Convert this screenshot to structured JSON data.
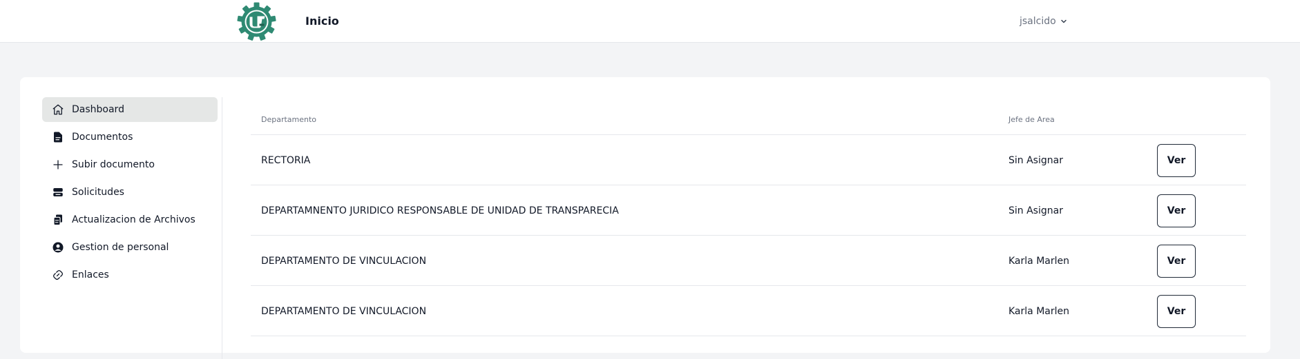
{
  "header": {
    "title": "Inicio",
    "user": "jsalcido",
    "logo_icon": "gear-logo-icon",
    "logo_color": "#2f8a73"
  },
  "sidebar": {
    "items": [
      {
        "label": "Dashboard",
        "icon": "home-icon",
        "active": true
      },
      {
        "label": "Documentos",
        "icon": "document-icon",
        "active": false
      },
      {
        "label": "Subir documento",
        "icon": "plus-icon",
        "active": false
      },
      {
        "label": "Solicitudes",
        "icon": "inbox-stack-icon",
        "active": false
      },
      {
        "label": "Actualizacion de Archivos",
        "icon": "copy-documents-icon",
        "active": false
      },
      {
        "label": "Gestion de personal",
        "icon": "user-circle-icon",
        "active": false
      },
      {
        "label": "Enlaces",
        "icon": "link-icon",
        "active": false
      }
    ]
  },
  "table": {
    "headers": {
      "departamento": "Departamento",
      "jefe": "Jefe de Area"
    },
    "rows": [
      {
        "departamento": "RECTORIA",
        "jefe": "Sin Asignar",
        "action": "Ver"
      },
      {
        "departamento": "DEPARTAMNENTO JURIDICO RESPONSABLE DE UNIDAD DE TRANSPARECIA",
        "jefe": "Sin Asignar",
        "action": "Ver"
      },
      {
        "departamento": "DEPARTAMENTO DE VINCULACION",
        "jefe": "Karla Marlen",
        "action": "Ver"
      },
      {
        "departamento": "DEPARTAMENTO DE VINCULACION",
        "jefe": "Karla Marlen",
        "action": "Ver"
      }
    ]
  },
  "colors": {
    "background": "#f3f4f6",
    "card": "#ffffff",
    "active_item": "#e5e7e6",
    "border": "#e5e7eb",
    "muted_text": "#6b7280"
  }
}
